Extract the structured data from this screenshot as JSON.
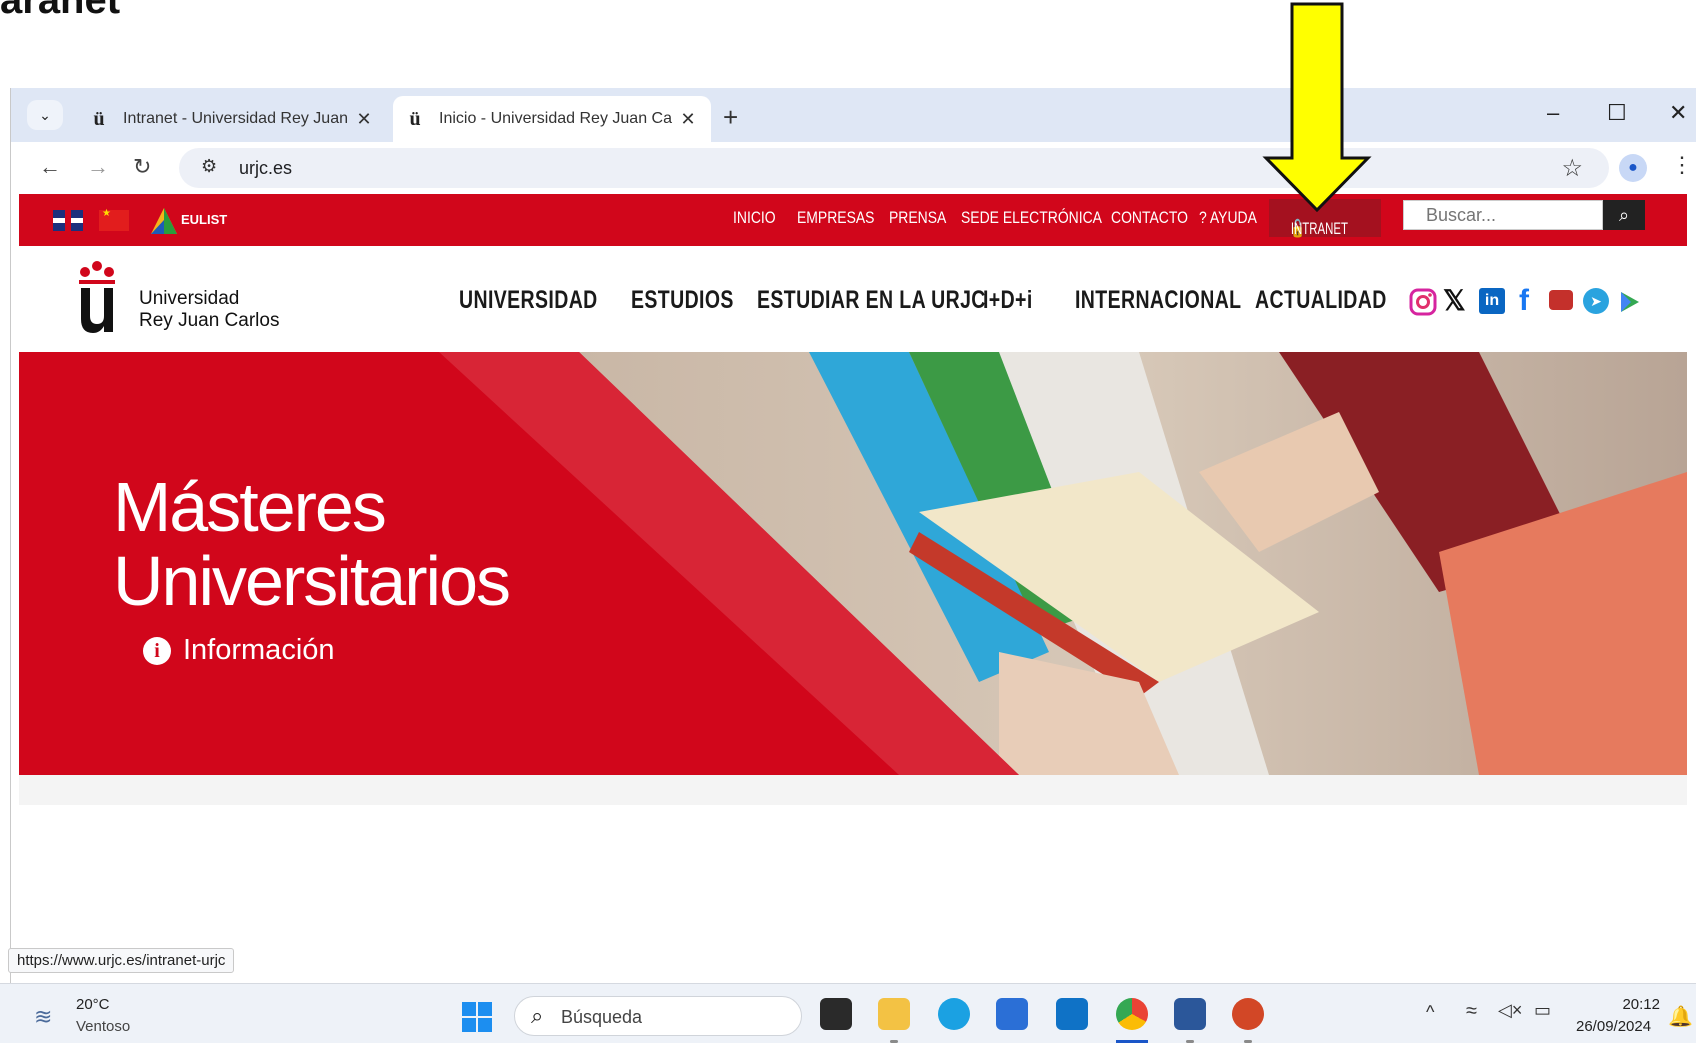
{
  "browser": {
    "tabs": [
      {
        "label": "Intranet - Universidad Rey Juan",
        "favicon": "ü",
        "close": "✕"
      },
      {
        "label": "Inicio - Universidad Rey Juan Ca",
        "favicon": "ü",
        "close": "✕"
      }
    ],
    "new_tab": "+",
    "url": "urjc.es",
    "window_controls": {
      "minimize": "–",
      "maximize": "☐",
      "close": "✕"
    },
    "status_link": "https://www.urjc.es/intranet-urjc"
  },
  "site": {
    "eulist": "EULIST",
    "top_nav": [
      "INICIO",
      "EMPRESAS",
      "PRENSA",
      "SEDE ELECTRÓNICA",
      "CONTACTO"
    ],
    "help_label": "AYUDA",
    "intranet_label": "INTRANET",
    "search_placeholder": "Buscar...",
    "logo_text_line1": "Universidad",
    "logo_text_line2": "Rey Juan Carlos",
    "main_nav": [
      "UNIVERSIDAD",
      "ESTUDIOS",
      "ESTUDIAR EN LA URJC",
      "I+D+i",
      "INTERNACIONAL",
      "ACTUALIDAD"
    ],
    "social_icons": [
      "instagram-icon",
      "x-icon",
      "linkedin-icon",
      "facebook-icon",
      "youtube-icon",
      "telegram-icon",
      "play-icon"
    ],
    "hero": {
      "title_line1": "Másteres",
      "title_line2": "Universitarios",
      "info_label": "Información"
    },
    "colors": {
      "brand_red": "#d1061b",
      "dark_red": "#a4111f"
    }
  },
  "taskbar": {
    "weather_temp": "20°C",
    "weather_desc": "Ventoso",
    "search_label": "Búsqueda",
    "time": "20:12",
    "date": "26/09/2024"
  },
  "annotation": {
    "arrow_color": "#ffff00"
  }
}
